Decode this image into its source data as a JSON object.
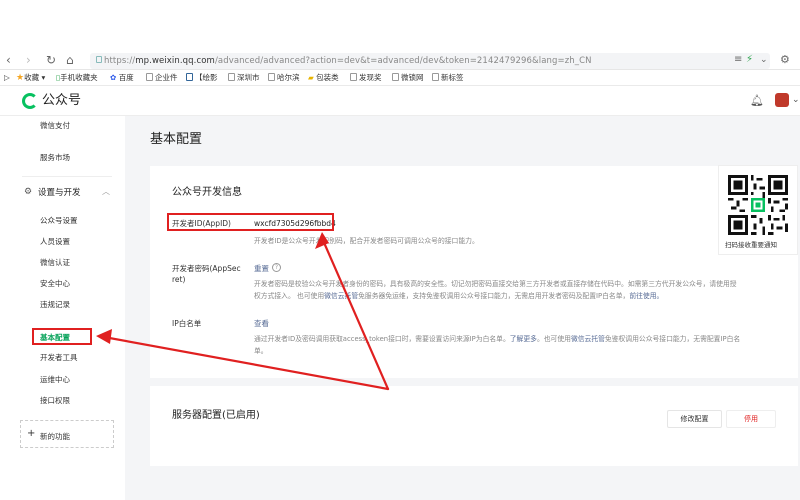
{
  "browser": {
    "url_scheme": "https://",
    "url_host": "mp.weixin.qq.com",
    "url_path": "/advanced/advanced?action=dev&t=advanced/dev&token=2142479296&lang=zh_CN",
    "bookmarks": [
      "收藏",
      "手机收藏夹",
      "百度",
      "企业件",
      "【绘影",
      "深圳市",
      "哈尔滨",
      "包装类",
      "发现奖",
      "微锁网",
      "新标签"
    ]
  },
  "app": {
    "logo_text": "公众号"
  },
  "sidebar": {
    "top_items": [
      "微信支付",
      "服务市场"
    ],
    "group_label": "设置与开发",
    "items": [
      "公众号设置",
      "人员设置",
      "微信认证",
      "安全中心",
      "违规记录",
      "基本配置",
      "开发者工具",
      "运维中心",
      "接口权限"
    ],
    "add_label": "新的功能"
  },
  "main": {
    "page_title": "基本配置",
    "section1_title": "公众号开发信息",
    "appid_label": "开发者ID(AppID)",
    "appid_value": "wxcfd7305d296fbbd4",
    "appid_desc": "开发者ID是公众号开发识别码，配合开发者密码可调用公众号的接口能力。",
    "secret_label_1": "开发者密码(AppSec",
    "secret_label_2": "ret)",
    "secret_action": "重置",
    "secret_desc_1": "开发者密码是校验公众号开发者身份的密码，具有极高的安全性。切记勿把密码直接交给第三方开发者或直接存储在代码中。如需第三方代开发公众号，请使用授",
    "secret_desc_2a": "权方式接入。 也可使用",
    "secret_desc_2b": "微信云托管",
    "secret_desc_2c": "免服务器免运维，支持免鉴权调用公众号接口能力，无需启用开发者密码及配置IP白名单，",
    "secret_desc_2d": "前往使用。",
    "ip_label": "IP白名单",
    "ip_action": "查看",
    "ip_desc_1a": "通过开发者ID及密码调用获取access_token接口时，需要设置访问来源IP为白名单。",
    "ip_desc_1b": "了解更多",
    "ip_desc_1c": "。也可使用",
    "ip_desc_1d": "微信云托管",
    "ip_desc_1e": "免鉴权调用公众号接口能力，无需配置IP白名",
    "ip_desc_2": "单。",
    "qr_label": "扫码接收重要通知",
    "section2_title": "服务器配置(已启用)",
    "modify_button": "修改配置",
    "stop_button": "停用"
  },
  "colors": {
    "accent_green": "#07c160",
    "annotation_red": "#e02020",
    "link_blue": "#576b95"
  }
}
